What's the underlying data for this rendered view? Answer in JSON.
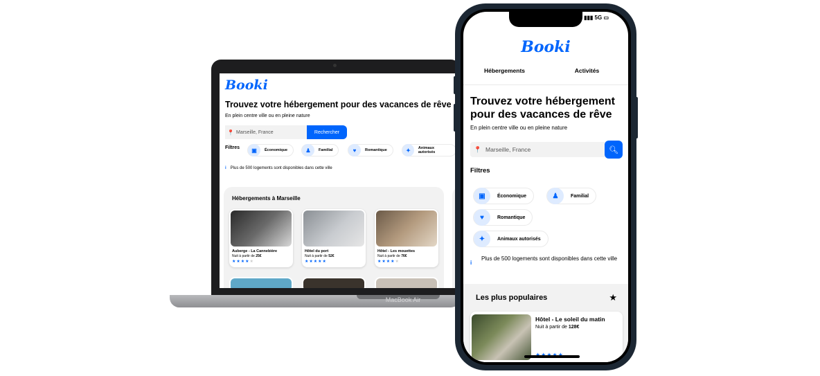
{
  "brand": {
    "logo": "Booki",
    "accent": "#0065fc"
  },
  "laptop": {
    "label": "MacBook Air",
    "title": "Trouvez votre hébergement pour des vacances de rêve",
    "subtitle": "En plein centre ville ou en pleine nature",
    "search": {
      "value": "Marseille, France",
      "button": "Rechercher"
    },
    "filters_label": "Filtres",
    "filters": [
      {
        "label": "Économique",
        "icon": "money-icon"
      },
      {
        "label": "Familial",
        "icon": "family-icon"
      },
      {
        "label": "Romantique",
        "icon": "heart-icon"
      },
      {
        "label": "Animaux autorisés",
        "icon": "dog-icon"
      }
    ],
    "info": "Plus de 500 logements sont disponibles dans cette ville",
    "section_title": "Hébergements à Marseille",
    "cards": [
      {
        "name": "Auberge - La Cannebière",
        "price_prefix": "Nuit à partir de",
        "price": "25€",
        "stars": 4
      },
      {
        "name": "Hôtel du port",
        "price_prefix": "Nuit à partir de",
        "price": "52€",
        "stars": 5
      },
      {
        "name": "Hôtel - Les mouettes",
        "price_prefix": "Nuit à partir de",
        "price": "76€",
        "stars": 4
      }
    ]
  },
  "phone": {
    "status": "5G",
    "nav": [
      "Hébergements",
      "Activités"
    ],
    "title": "Trouvez votre hébergement pour des vacances de rêve",
    "subtitle": "En plein centre ville ou en pleine nature",
    "search": {
      "placeholder": "Marseille, France"
    },
    "filters_label": "Filtres",
    "filters": [
      {
        "label": "Économique",
        "icon": "money-icon"
      },
      {
        "label": "Familial",
        "icon": "family-icon"
      },
      {
        "label": "Romantique",
        "icon": "heart-icon"
      },
      {
        "label": "Animaux autorisés",
        "icon": "dog-icon"
      }
    ],
    "info": "Plus de 500 logements sont disponibles dans cette ville",
    "popular_title": "Les plus populaires",
    "popular_card": {
      "name": "Hôtel - Le soleil du matin",
      "price_prefix": "Nuit à partir de",
      "price": "128€",
      "stars": 5
    }
  }
}
